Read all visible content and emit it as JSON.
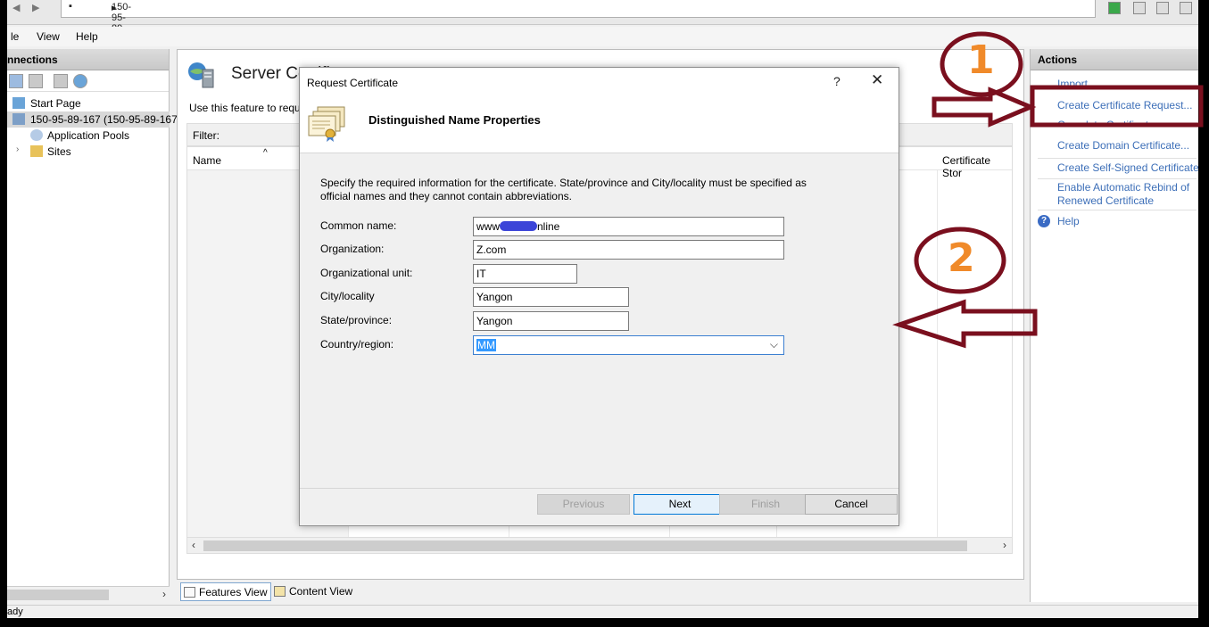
{
  "address": {
    "breadcrumb": "150-95-89-167",
    "separator": "▸"
  },
  "menu": [
    "le",
    "View",
    "Help"
  ],
  "connections": {
    "title": "nnections",
    "tree": [
      {
        "label": "Start Page",
        "icon": "start-page-icon"
      },
      {
        "label": "150-95-89-167 (150-95-89-167",
        "icon": "server-icon",
        "selected": true
      },
      {
        "label": "Application Pools",
        "icon": "app-pools-icon"
      },
      {
        "label": "Sites",
        "icon": "sites-icon"
      }
    ]
  },
  "center": {
    "title": "Server Certificates",
    "description": "Use this feature to request",
    "filter_label": "Filter:",
    "columns": {
      "name": "Name",
      "store": "Certificate Stor"
    },
    "view_tabs": {
      "features": "Features View",
      "content": "Content View"
    }
  },
  "actions": {
    "title": "Actions",
    "items": [
      "Import...",
      "Create Certificate Request...",
      "Complete Certificate Request...",
      "Create Domain Certificate...",
      "Create Self-Signed Certificate...",
      "Enable Automatic Rebind of Renewed Certificate"
    ],
    "help": "Help"
  },
  "status": {
    "text": "ady"
  },
  "dialog": {
    "title": "Request Certificate",
    "help_glyph": "?",
    "close_glyph": "✕",
    "heading": "Distinguished Name Properties",
    "instructions": "Specify the required information for the certificate. State/province and City/locality must be specified as official names and they cannot contain abbreviations.",
    "fields": {
      "common_name": {
        "label": "Common name:",
        "prefix": "www",
        "suffix": "nline"
      },
      "organization": {
        "label": "Organization:",
        "value": "Z.com"
      },
      "org_unit": {
        "label": "Organizational unit:",
        "value": "IT"
      },
      "city": {
        "label": "City/locality",
        "value": "Yangon"
      },
      "state": {
        "label": "State/province:",
        "value": "Yangon"
      },
      "country": {
        "label": "Country/region:",
        "value": "MM"
      }
    },
    "buttons": {
      "previous": "Previous",
      "next": "Next",
      "finish": "Finish",
      "cancel": "Cancel"
    }
  },
  "annotations": {
    "step1": "1",
    "step2": "2"
  },
  "colors": {
    "annotation_red": "#7a0f1e",
    "annotation_orange": "#f08a2a",
    "link_blue": "#3d6fb8",
    "selection_blue": "#3399ff"
  }
}
